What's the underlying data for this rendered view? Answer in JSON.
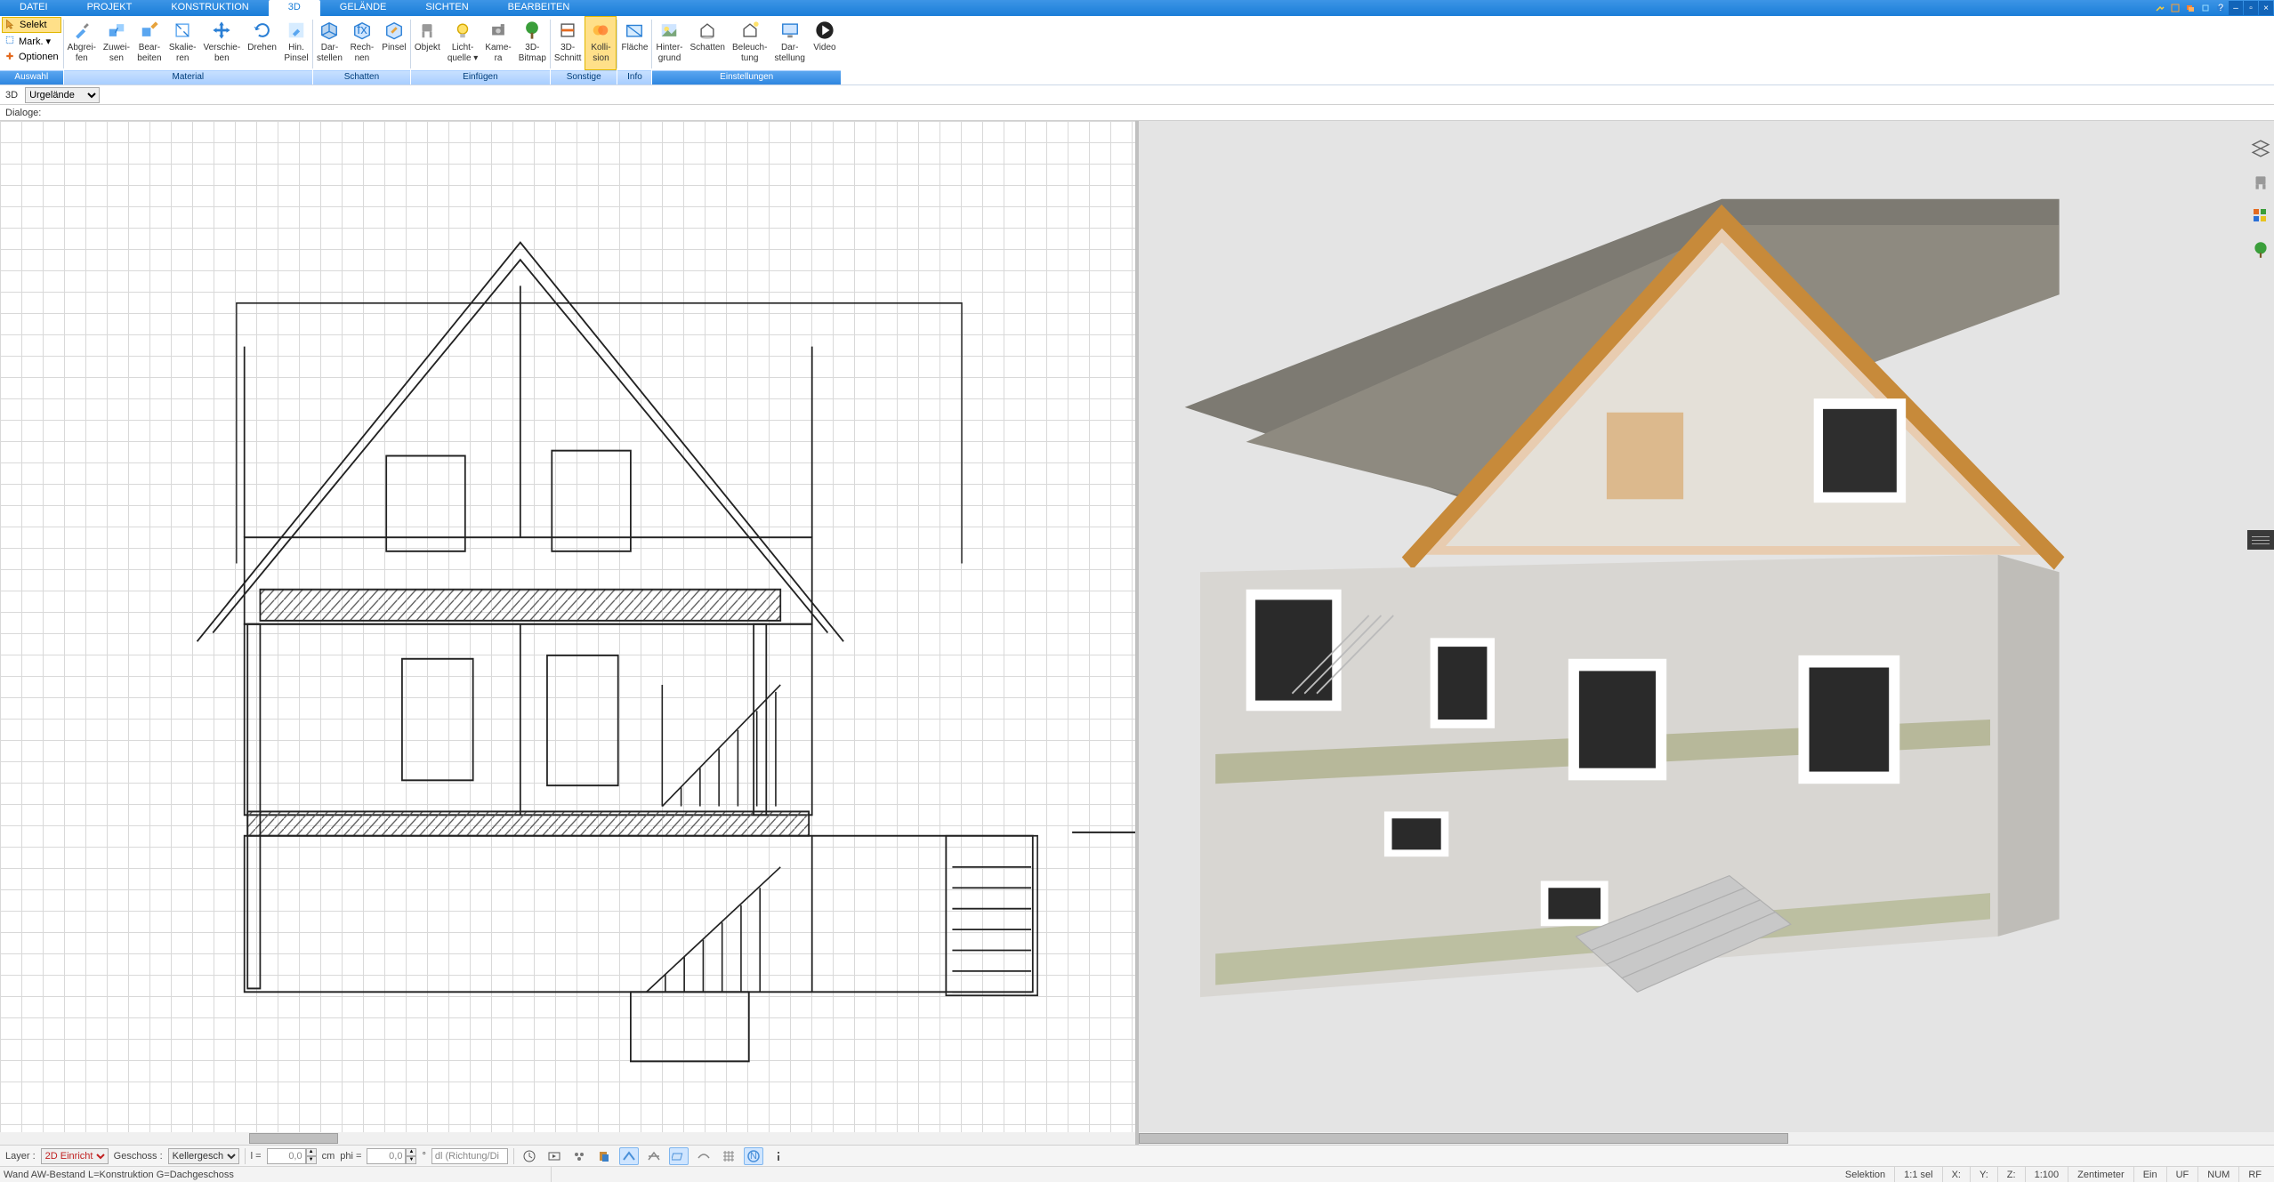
{
  "menu": {
    "tabs": [
      "DATEI",
      "PROJEKT",
      "KONSTRUKTION",
      "3D",
      "GELÄNDE",
      "SICHTEN",
      "BEARBEITEN"
    ],
    "active_index": 3
  },
  "title_icons": [
    "tools-icon",
    "window-icon",
    "layers-icon",
    "restore-icon",
    "help-icon"
  ],
  "window_controls": [
    "minimize",
    "maximize",
    "close"
  ],
  "ribbon": {
    "groups": [
      {
        "caption": "Auswahl",
        "selcol": true,
        "items": [
          {
            "label": "Selekt",
            "icon": "cursor-icon",
            "active": true
          },
          {
            "label": "Mark.",
            "icon": "mark-icon",
            "dropdown": true
          },
          {
            "label": "Optionen",
            "icon": "plus-icon",
            "orange": true
          }
        ]
      },
      {
        "caption": "Material",
        "buttons": [
          {
            "l1": "Abgrei-",
            "l2": "fen",
            "icon": "eyedropper-icon"
          },
          {
            "l1": "Zuwei-",
            "l2": "sen",
            "icon": "assign-icon"
          },
          {
            "l1": "Bear-",
            "l2": "beiten",
            "icon": "edit-material-icon"
          },
          {
            "l1": "Skalie-",
            "l2": "ren",
            "icon": "scale-icon"
          },
          {
            "l1": "Verschie-",
            "l2": "ben",
            "icon": "move-icon"
          },
          {
            "l1": "Drehen",
            "l2": "",
            "icon": "rotate-icon"
          },
          {
            "l1": "Hin.",
            "l2": "Pinsel",
            "icon": "brush-bg-icon"
          }
        ]
      },
      {
        "caption": "Schatten",
        "buttons": [
          {
            "l1": "Dar-",
            "l2": "stellen",
            "icon": "cube-show-icon"
          },
          {
            "l1": "Rech-",
            "l2": "nen",
            "icon": "cube-calc-icon"
          },
          {
            "l1": "Pinsel",
            "l2": "",
            "icon": "cube-brush-icon"
          }
        ]
      },
      {
        "caption": "Einfügen",
        "buttons": [
          {
            "l1": "Objekt",
            "l2": "",
            "icon": "chair-icon"
          },
          {
            "l1": "Licht-",
            "l2": "quelle",
            "icon": "bulb-icon",
            "dropdown": true
          },
          {
            "l1": "Kame-",
            "l2": "ra",
            "icon": "camera-icon"
          },
          {
            "l1": "3D-",
            "l2": "Bitmap",
            "icon": "tree-icon"
          }
        ]
      },
      {
        "caption": "Sonstige",
        "buttons": [
          {
            "l1": "3D-",
            "l2": "Schnitt",
            "icon": "section-icon"
          },
          {
            "l1": "Kolli-",
            "l2": "sion",
            "icon": "collision-icon",
            "active": true
          }
        ]
      },
      {
        "caption": "Info",
        "buttons": [
          {
            "l1": "Fläche",
            "l2": "",
            "icon": "surface-icon"
          }
        ]
      },
      {
        "caption": "Einstellungen",
        "selmode": true,
        "buttons": [
          {
            "l1": "Hinter-",
            "l2": "grund",
            "icon": "background-icon"
          },
          {
            "l1": "Schatten",
            "l2": "",
            "icon": "shadow-house-icon"
          },
          {
            "l1": "Beleuch-",
            "l2": "tung",
            "icon": "lighting-icon"
          },
          {
            "l1": "Dar-",
            "l2": "stellung",
            "icon": "display-icon"
          },
          {
            "l1": "Video",
            "l2": "",
            "icon": "play-icon"
          }
        ]
      }
    ]
  },
  "context": {
    "view_label": "3D",
    "terrain_select": "Urgelände"
  },
  "dialogs_label": "Dialoge:",
  "side_tools": [
    {
      "name": "layers-icon",
      "title": "Layer"
    },
    {
      "name": "chair-icon",
      "title": "Objekte"
    },
    {
      "name": "palette-icon",
      "title": "Material"
    },
    {
      "name": "tree-icon",
      "title": "Pflanzen"
    }
  ],
  "bottom": {
    "layer_label": "Layer :",
    "layer_value": "2D Einricht",
    "floor_label": "Geschoss :",
    "floor_value": "Kellergesch",
    "l_label": "l =",
    "l_value": "0,0",
    "l_unit": "cm",
    "phi_label": "phi =",
    "phi_value": "0,0",
    "phi_unit": "°",
    "dir_placeholder": "dl (Richtung/Di"
  },
  "status": {
    "info": "Wand AW-Bestand L=Konstruktion G=Dachgeschoss",
    "mode": "Selektion",
    "sel": "1:1 sel",
    "x": "X:",
    "y": "Y:",
    "z": "Z:",
    "scale": "1:100",
    "unit": "Zentimeter",
    "ein": "Ein",
    "uf": "UF",
    "num": "NUM",
    "rf": "RF"
  }
}
